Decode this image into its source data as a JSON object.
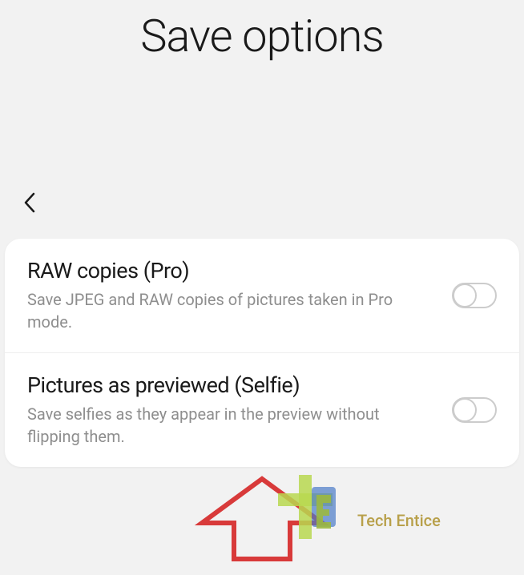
{
  "page": {
    "title": "Save options"
  },
  "settings": {
    "raw_copies": {
      "title": "RAW copies (Pro)",
      "description": "Save JPEG and RAW copies of pictures taken in Pro mode.",
      "enabled": false
    },
    "pictures_previewed": {
      "title": "Pictures as previewed (Selfie)",
      "description": "Save selfies as they appear in the preview without flipping them.",
      "enabled": false
    }
  },
  "watermark": {
    "text": "Tech Entice"
  }
}
